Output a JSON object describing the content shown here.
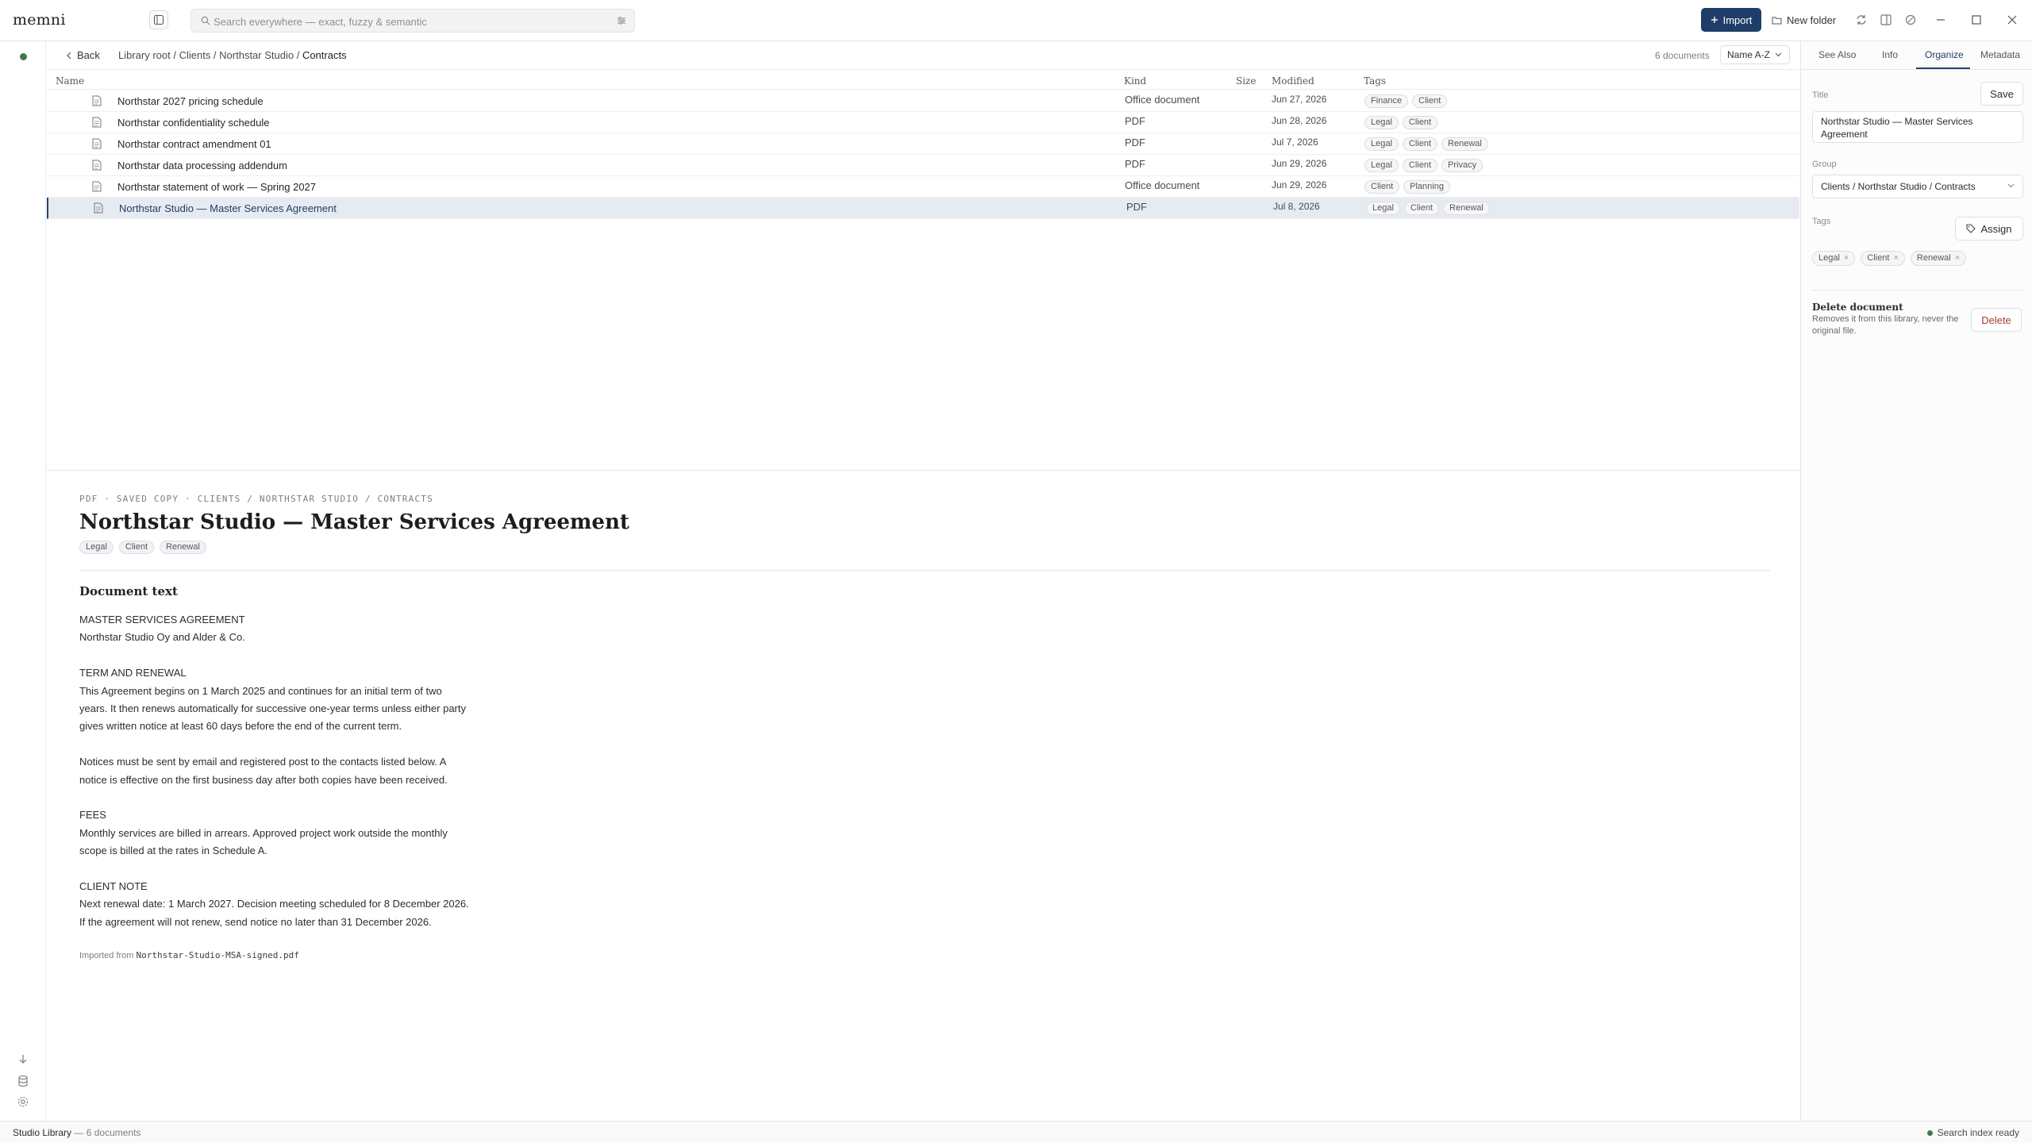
{
  "app": {
    "logo": "memni",
    "search_placeholder": "Search everywhere — exact, fuzzy & semantic",
    "import_label": "Import",
    "new_folder_label": "New folder"
  },
  "breadcrumb": {
    "back_label": "Back",
    "path": "Library root / Clients / Northstar Studio / ",
    "current": "Contracts",
    "count": "6 documents",
    "sort": "Name A-Z"
  },
  "table": {
    "columns": {
      "name": "Name",
      "kind": "Kind",
      "size": "Size",
      "modified": "Modified",
      "tags": "Tags"
    },
    "rows": [
      {
        "name": "Northstar 2027 pricing schedule",
        "kind": "Office document",
        "modified": "Jun 27, 2026",
        "tags": [
          "Finance",
          "Client"
        ]
      },
      {
        "name": "Northstar confidentiality schedule",
        "kind": "PDF",
        "modified": "Jun 28, 2026",
        "tags": [
          "Legal",
          "Client"
        ]
      },
      {
        "name": "Northstar contract amendment 01",
        "kind": "PDF",
        "modified": "Jul 7, 2026",
        "tags": [
          "Legal",
          "Client",
          "Renewal"
        ]
      },
      {
        "name": "Northstar data processing addendum",
        "kind": "PDF",
        "modified": "Jun 29, 2026",
        "tags": [
          "Legal",
          "Client",
          "Privacy"
        ]
      },
      {
        "name": "Northstar statement of work — Spring 2027",
        "kind": "Office document",
        "modified": "Jun 29, 2026",
        "tags": [
          "Client",
          "Planning"
        ]
      },
      {
        "name": "Northstar Studio — Master Services Agreement",
        "kind": "PDF",
        "modified": "Jul 8, 2026",
        "tags": [
          "Legal",
          "Client",
          "Renewal"
        ]
      }
    ]
  },
  "preview": {
    "meta": "PDF · SAVED COPY · CLIENTS / NORTHSTAR STUDIO / CONTRACTS",
    "title": "Northstar Studio — Master Services Agreement",
    "tags": [
      "Legal",
      "Client",
      "Renewal"
    ],
    "section_heading": "Document text",
    "lines": [
      "MASTER SERVICES AGREEMENT",
      "Northstar Studio Oy and Alder & Co.",
      "",
      "TERM AND RENEWAL",
      "This Agreement begins on 1 March 2025 and continues for an initial term of two",
      "years. It then renews automatically for successive one-year terms unless either party",
      "gives written notice at least 60 days before the end of the current term.",
      "",
      "Notices must be sent by email and registered post to the contacts listed below. A",
      "notice is effective on the first business day after both copies have been received.",
      "",
      "FEES",
      "Monthly services are billed in arrears. Approved project work outside the monthly",
      "scope is billed at the rates in Schedule A.",
      "",
      "CLIENT NOTE",
      "Next renewal date: 1 March 2027. Decision meeting scheduled for 8 December 2026.",
      "If the agreement will not renew, send notice no later than 31 December 2026."
    ],
    "imported_label": "Imported from",
    "imported_file": "Northstar-Studio-MSA-signed.pdf"
  },
  "panel": {
    "tabs": [
      "See Also",
      "Info",
      "Organize",
      "Metadata"
    ],
    "active_tab": "Organize",
    "title_label": "Title",
    "save_label": "Save",
    "title_value": "Northstar Studio — Master Services Agreement",
    "group_label": "Group",
    "group_value": "Clients / Northstar Studio / Contracts",
    "tags_label": "Tags",
    "assign_label": "Assign",
    "tags": [
      "Legal",
      "Client",
      "Renewal"
    ],
    "delete_title": "Delete document",
    "delete_desc": "Removes it from this library, never the original file.",
    "delete_label": "Delete"
  },
  "status": {
    "library": "Studio Library",
    "count": " — 6 documents",
    "index": "Search index ready"
  },
  "colors": {
    "accent": "#1f3e67",
    "ok": "#3f7a4e",
    "danger": "#a43b2e"
  }
}
